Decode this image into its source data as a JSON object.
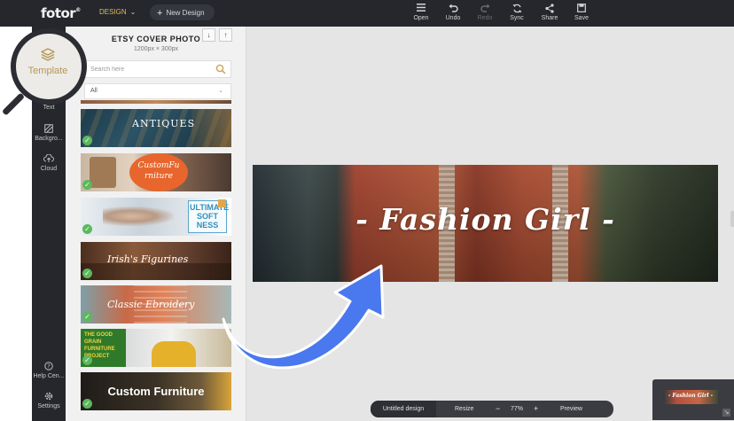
{
  "header": {
    "logo": "fotor",
    "logo_mark": "®",
    "design_menu": "DESIGN",
    "new_design": "New Design",
    "tools": [
      {
        "label": "Open",
        "icon": "menu-icon",
        "enabled": true
      },
      {
        "label": "Undo",
        "icon": "undo-icon",
        "enabled": true
      },
      {
        "label": "Redo",
        "icon": "redo-icon",
        "enabled": false
      },
      {
        "label": "Sync",
        "icon": "sync-icon",
        "enabled": true
      },
      {
        "label": "Share",
        "icon": "share-icon",
        "enabled": true
      },
      {
        "label": "Save",
        "icon": "save-icon",
        "enabled": true
      }
    ]
  },
  "rail": {
    "template": "Template",
    "text": "Text",
    "background": "Backgro...",
    "cloud": "Cloud",
    "help": "Help Cen...",
    "settings": "Settings"
  },
  "panel": {
    "title": "ETSY COVER PHOTO",
    "size": "1200px × 300px",
    "search_placeholder": "Search here",
    "filter_value": "All",
    "templates": [
      {
        "text": "ANTIQUES",
        "checked": true
      },
      {
        "text": "CustomFu rniture",
        "checked": true
      },
      {
        "text": "ULTIMATE SOFT NESS",
        "checked": true
      },
      {
        "text": "Irish's Figurines",
        "checked": true
      },
      {
        "text": "Classic Ebroidery",
        "checked": true
      },
      {
        "text": "THE GOOD GRAIN FURNITURE PROJECT",
        "checked": true
      },
      {
        "text": "Custom Furniture",
        "checked": true
      }
    ]
  },
  "canvas": {
    "banner_text": "- Fashion Girl -",
    "minimap_text": "- Fashion Girl -"
  },
  "bottom_bar": {
    "design_name": "Untitled design",
    "resize": "Resize",
    "zoom_out": "−",
    "zoom": "77%",
    "zoom_in": "+",
    "preview": "Preview"
  },
  "colors": {
    "accent_gold": "#b89652",
    "topbar": "#25272d",
    "arrow_blue": "#4a78ee",
    "check_green": "#5cb85c"
  }
}
